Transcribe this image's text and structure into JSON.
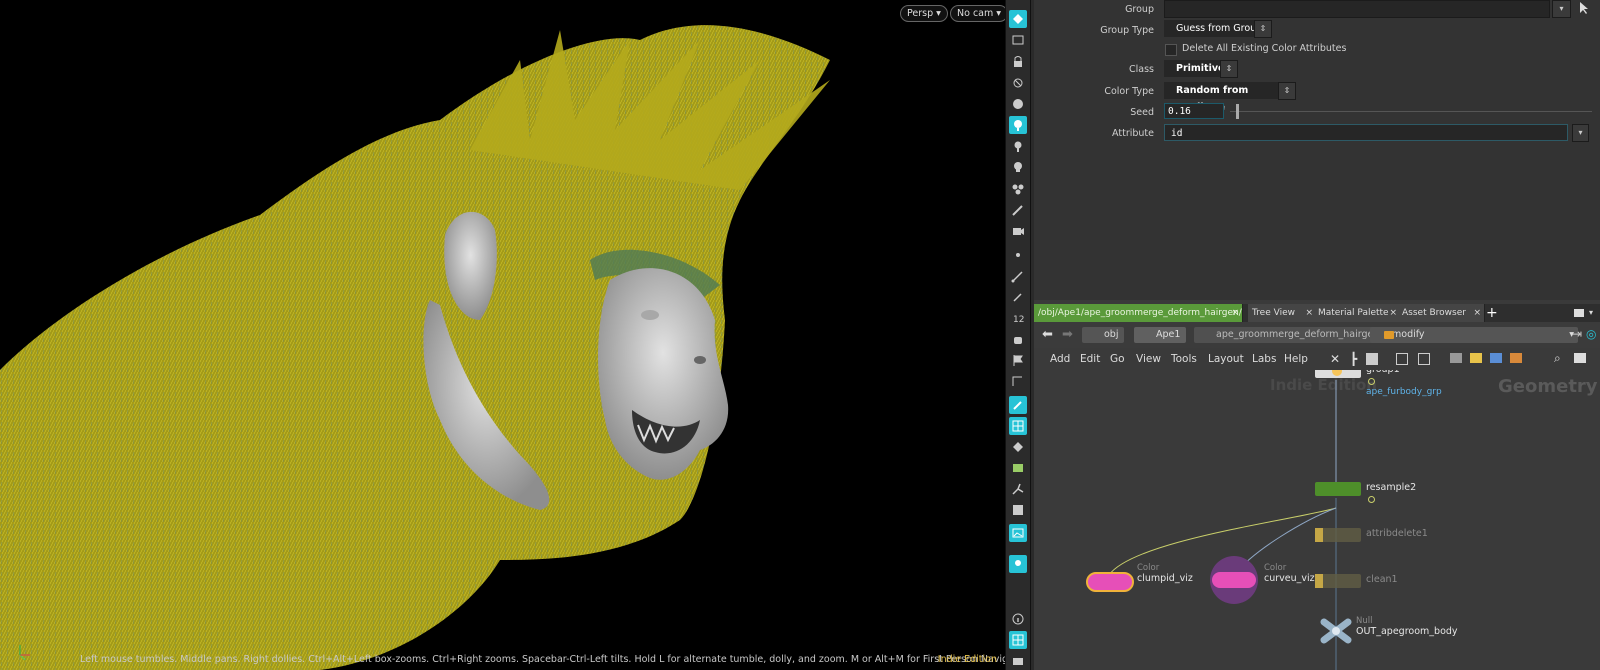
{
  "viewport": {
    "camera_menu": "Persp",
    "cam_menu": "No cam",
    "status_text": "Left mouse tumbles. Middle pans. Right dollies. Ctrl+Alt+Left box-zooms. Ctrl+Right zooms. Spacebar-Ctrl-Left tilts. Hold L for alternate tumble, dolly, and zoom.     M or Alt+M for First Person Navigation.",
    "edition": "Indie Edition",
    "fur_color": "#a39a17"
  },
  "parameters": {
    "group_label": "Group",
    "group_value": "",
    "group_type_label": "Group Type",
    "group_type_value": "Guess from Group",
    "delete_checkbox_label": "Delete All Existing Color Attributes",
    "delete_checkbox_checked": false,
    "class_label": "Class",
    "class_value": "Primitive",
    "color_type_label": "Color Type",
    "color_type_value": "Random from Attribute",
    "seed_label": "Seed",
    "seed_value": "0.16",
    "attribute_label": "Attribute",
    "attribute_value": "id"
  },
  "tabs": [
    {
      "label": "/obj/Ape1/ape_groommerge_deform_hairgen/mo...",
      "active": true
    },
    {
      "label": "Tree View",
      "active": false
    },
    {
      "label": "Material Palette",
      "active": false
    },
    {
      "label": "Asset Browser",
      "active": false
    }
  ],
  "breadcrumb": {
    "obj": "obj",
    "ape": "Ape1",
    "hairgen": "ape_groommerge_deform_hairgen",
    "modify": "modify"
  },
  "menus": [
    "Add",
    "Edit",
    "Go",
    "View",
    "Tools",
    "Layout",
    "Labs",
    "Help"
  ],
  "network": {
    "watermark": "Indie Edition",
    "context": "Geometry",
    "nodes": {
      "group1": {
        "name": "group1",
        "comment": "ape_furbody_grp"
      },
      "resample2": {
        "name": "resample2"
      },
      "attribdelete1": {
        "name": "attribdelete1"
      },
      "clean1": {
        "name": "clean1"
      },
      "clumpid_viz": {
        "name": "clumpid_viz",
        "type": "Color"
      },
      "curveu_viz": {
        "name": "curveu_viz",
        "type": "Color"
      },
      "out": {
        "name": "OUT_apegroom_body",
        "type": "Null"
      }
    }
  },
  "toolbar_icons": [
    "select-icon",
    "handle-icon",
    "lock-icon",
    "light-icon",
    "sphere-icon",
    "point-light-icon",
    "bulb-icon",
    "skull-icon",
    "cluster-icon",
    "brush-icon",
    "camera-icon",
    "dot-icon",
    "pen-icon",
    "pencil-icon",
    "numbers-icon",
    "hand-icon",
    "flag-icon",
    "ruler-icon",
    "paint-icon",
    "grid-icon",
    "diamond-icon",
    "map-icon",
    "bones-icon",
    "panel-icon",
    "image-icon",
    "location-icon",
    "info-icon",
    "layout-icon",
    "camera-save-icon"
  ]
}
